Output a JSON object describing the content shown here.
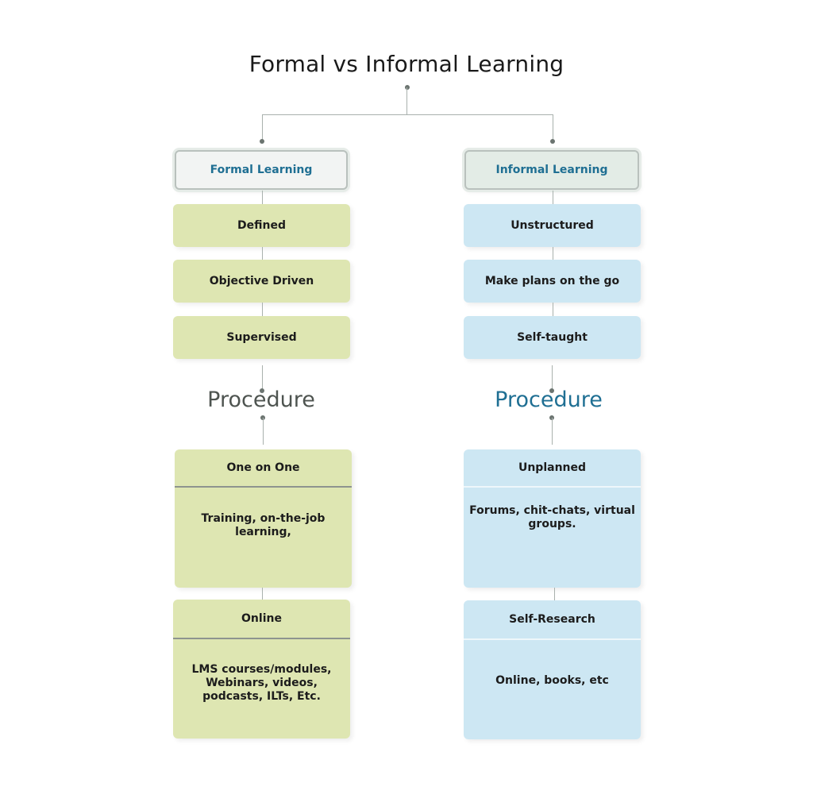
{
  "title": "Formal vs Informal Learning",
  "colors": {
    "formal_box": "#dee6b2",
    "informal_box": "#cde7f3",
    "header_text": "#1f6f93",
    "procedure_formal": "#4e5450",
    "procedure_informal": "#1f6f93",
    "connector": "#a9b1ad"
  },
  "formal": {
    "header": "Formal Learning",
    "traits": [
      "Defined",
      "Objective Driven",
      "Supervised"
    ],
    "procedure_label": "Procedure",
    "procedures": [
      {
        "title": "One on One",
        "body": "Training, on-the-job learning,"
      },
      {
        "title": "Online",
        "body": "LMS courses/modules, Webinars, videos, podcasts, ILTs, Etc."
      }
    ]
  },
  "informal": {
    "header": "Informal Learning",
    "traits": [
      "Unstructured",
      "Make plans on the go",
      "Self-taught"
    ],
    "procedure_label": "Procedure",
    "procedures": [
      {
        "title": "Unplanned",
        "body": "Forums, chit-chats, virtual groups."
      },
      {
        "title": "Self-Research",
        "body": "Online, books, etc"
      }
    ]
  }
}
